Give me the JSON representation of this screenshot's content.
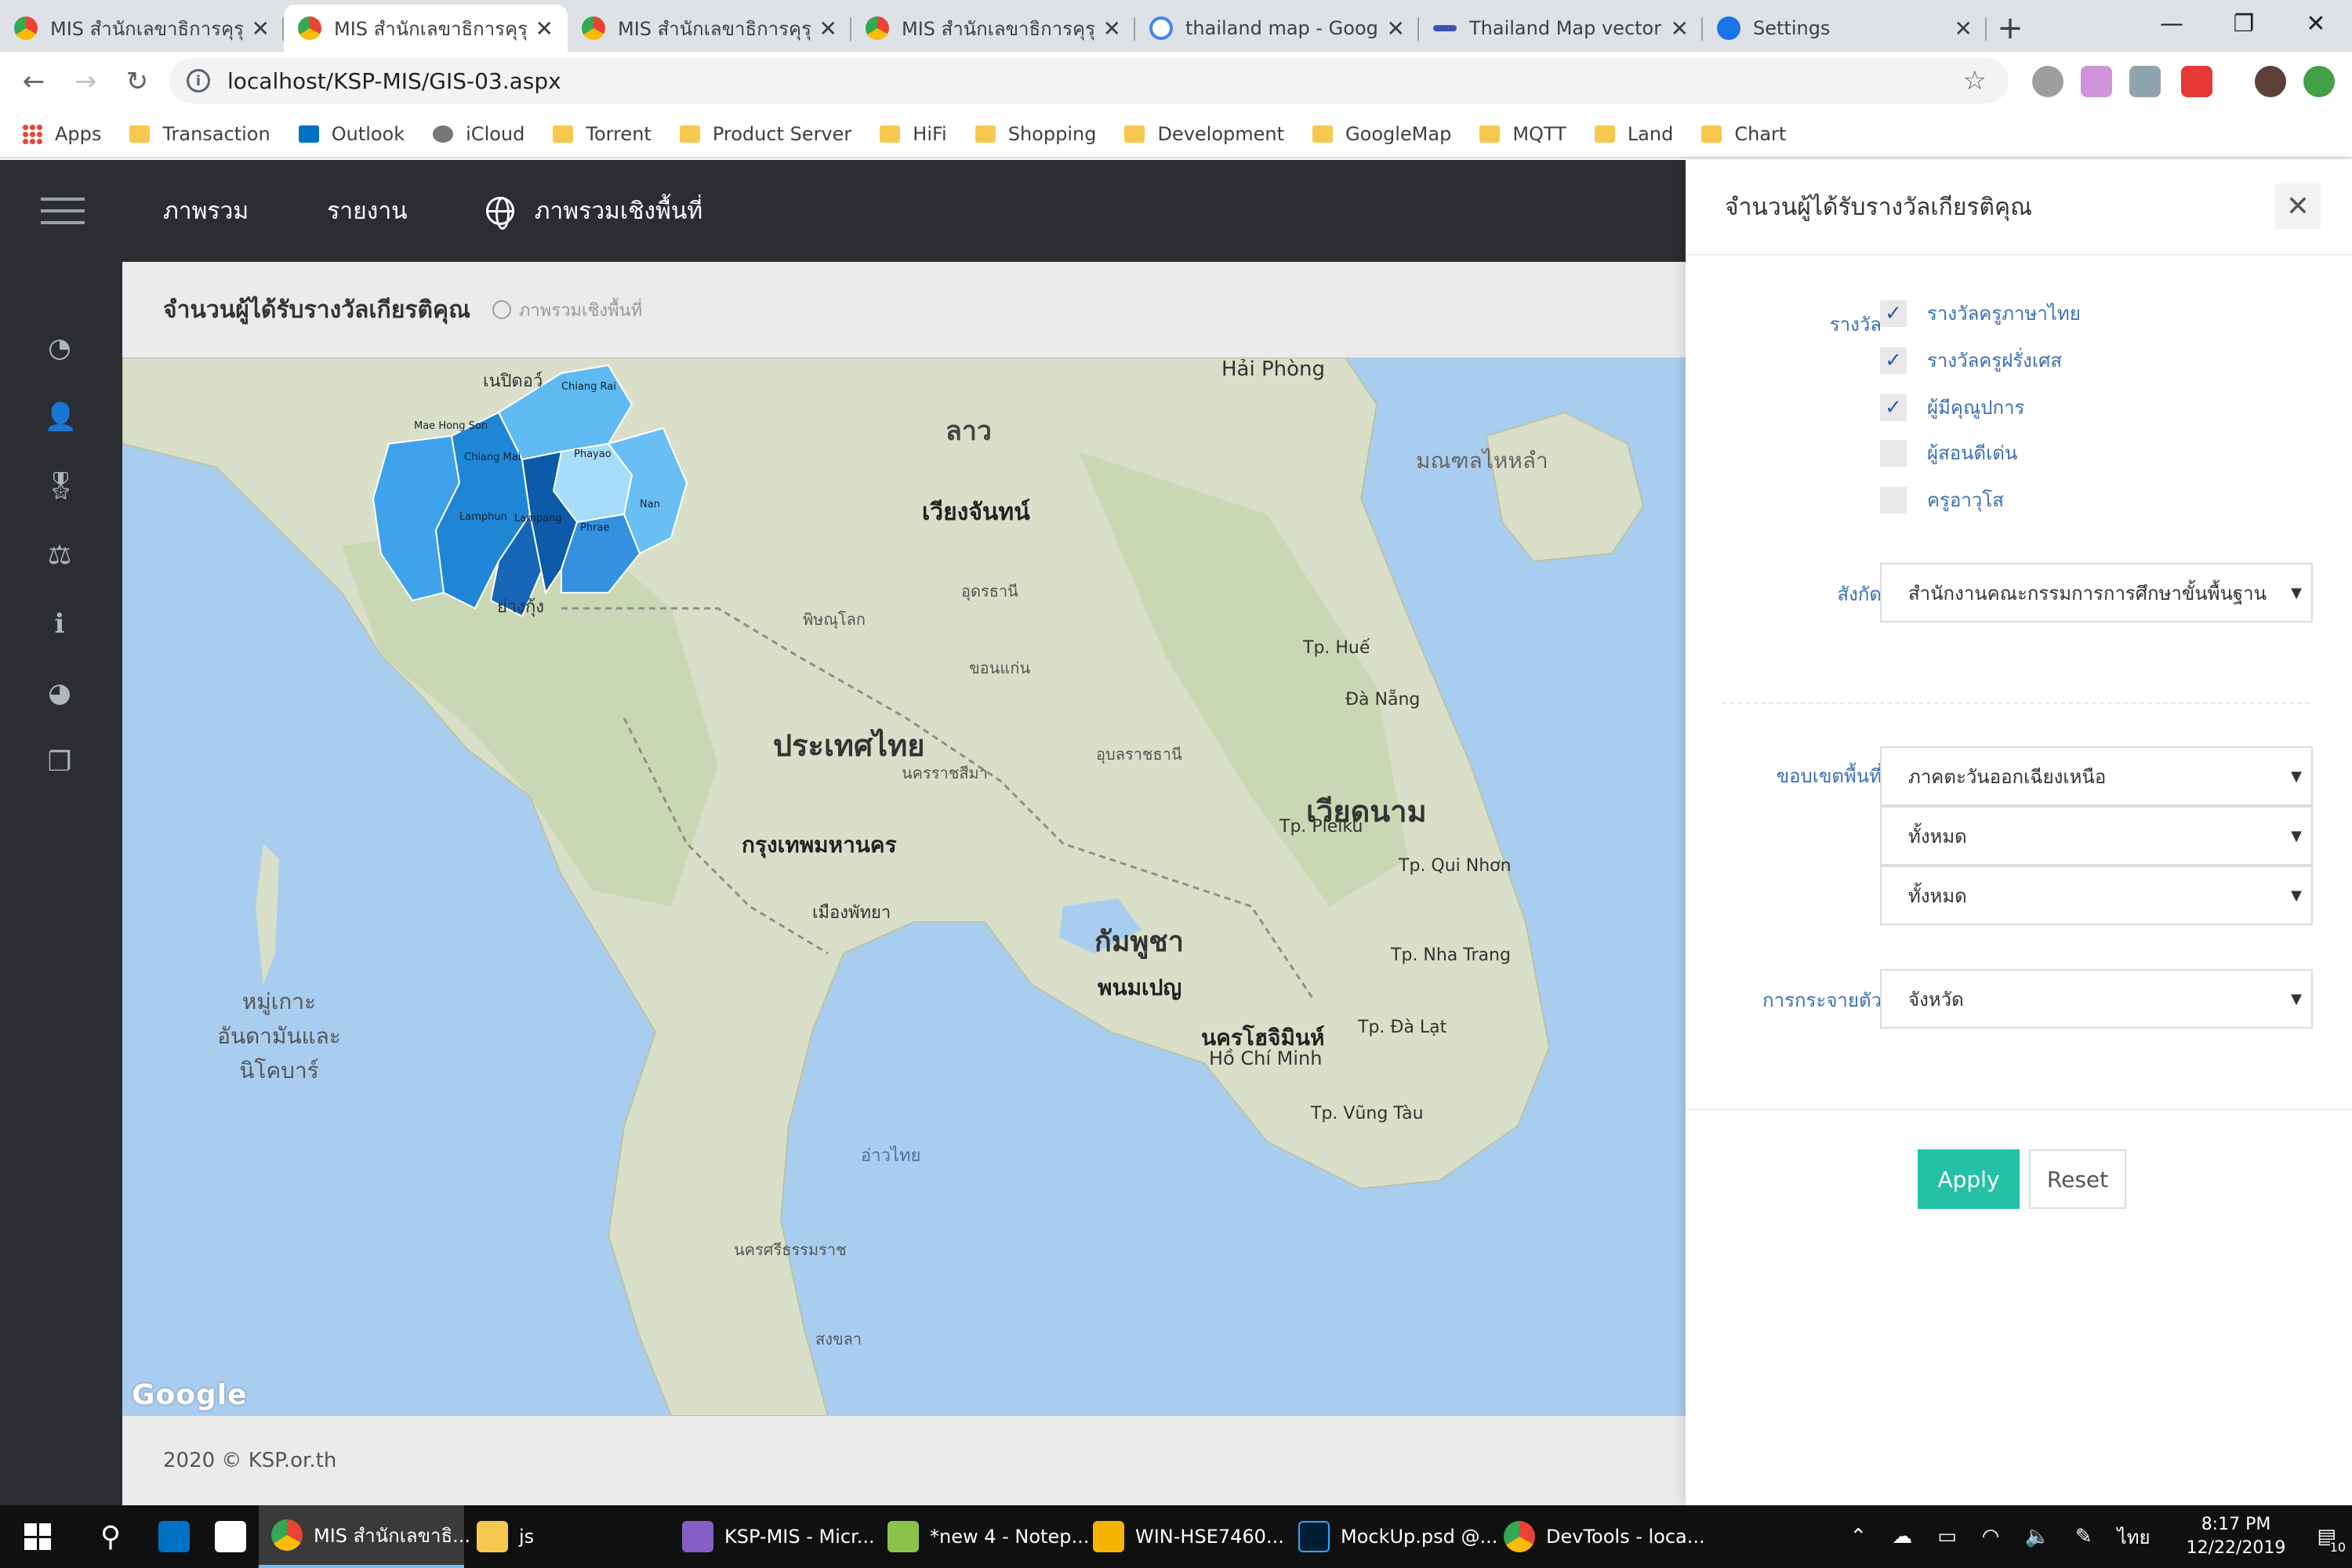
{
  "browser": {
    "tabs": [
      {
        "title": "MIS สำนักเลขาธิการคุรุสภา",
        "active": false
      },
      {
        "title": "MIS สำนักเลขาธิการคุรุสภา",
        "active": true
      },
      {
        "title": "MIS สำนักเลขาธิการคุรุสภา",
        "active": false
      },
      {
        "title": "MIS สำนักเลขาธิการคุรุสภา",
        "active": false
      },
      {
        "title": "thailand map - Google Search",
        "active": false
      },
      {
        "title": "Thailand Map vector free",
        "active": false
      },
      {
        "title": "Settings",
        "active": false
      }
    ],
    "url": "localhost/KSP-MIS/GIS-03.aspx",
    "bookmarks": [
      "Apps",
      "Transaction",
      "Outlook",
      "iCloud",
      "Torrent",
      "Product Server",
      "HiFi",
      "Shopping",
      "Development",
      "GoogleMap",
      "MQTT",
      "Land",
      "Chart"
    ]
  },
  "app": {
    "nav": {
      "overview": "ภาพรวม",
      "report": "รายงาน",
      "geo": "ภาพรวมเชิงพื้นที่"
    },
    "page_title": "จำนวนผู้ได้รับรางวัลเกียรติคุณ",
    "breadcrumb_sub": "ภาพรวมเชิงพื้นที่",
    "footer": "2020 © KSP.or.th",
    "map": {
      "google_logo": "Google",
      "provinces": [
        "Mae Hong Son",
        "Chiang Rai",
        "Chiang Mai",
        "Phayao",
        "Lamphun",
        "Lampang",
        "Phrae",
        "Nan"
      ],
      "labels": [
        {
          "text": "ลาว"
        },
        {
          "text": "ประเทศไทย"
        },
        {
          "text": "กรุงเทพมหานคร"
        },
        {
          "text": "กัมพูชา"
        },
        {
          "text": "เวียดนาม"
        },
        {
          "text": "เวียงจันทน์"
        },
        {
          "text": "พนมเปญ"
        },
        {
          "text": "นครโฮจิมินห์"
        },
        {
          "text": "Hải Phòng"
        },
        {
          "text": "มณฑลไหหลำ"
        },
        {
          "text": "อ่าวไทย"
        },
        {
          "text": "หมู่เกาะอันดามันและนิโคบาร์"
        },
        {
          "text": "Tp. Huế"
        },
        {
          "text": "Đà Nẵng"
        },
        {
          "text": "Tp. Pleiku"
        },
        {
          "text": "Tp. Qui Nhơn"
        },
        {
          "text": "Tp. Nha Trang"
        },
        {
          "text": "Tp. Đà Lạt"
        },
        {
          "text": "Hồ Chí Minh"
        },
        {
          "text": "Tp. Vũng Tàu"
        },
        {
          "text": "ย่างกุ้ง"
        },
        {
          "text": "เนปิดอว์"
        },
        {
          "text": "อุดรธานี"
        },
        {
          "text": "ขอนแก่น"
        },
        {
          "text": "อุบลราชธานี"
        },
        {
          "text": "นครราชสีมา"
        },
        {
          "text": "พิษณุโลก"
        },
        {
          "text": "เมืองพัทยา"
        },
        {
          "text": "สงขลา"
        },
        {
          "text": "นครศรีธรรมราช"
        }
      ]
    }
  },
  "filter": {
    "title": "จำนวนผู้ได้รับรางวัลเกียรติคุณ",
    "award_label": "รางวัล",
    "awards": [
      {
        "label": "รางวัลครูภาษาไทย",
        "checked": true
      },
      {
        "label": "รางวัลครูฝรั่งเศส",
        "checked": true
      },
      {
        "label": "ผู้มีคุณูปการ",
        "checked": true
      },
      {
        "label": "ผู้สอนดีเด่น",
        "checked": false
      },
      {
        "label": "ครูอาวุโส",
        "checked": false
      }
    ],
    "affiliation_label": "สังกัด",
    "affiliation_value": "สำนักงานคณะกรรมการการศึกษาขั้นพื้นฐาน",
    "area_label": "ขอบเขตพื้นที่",
    "area_values": [
      "ภาคตะวันออกเฉียงเหนือ",
      "ทั้งหมด",
      "ทั้งหมด"
    ],
    "distribution_label": "การกระจายตัว",
    "distribution_value": "จังหวัด",
    "apply": "Apply",
    "reset": "Reset"
  },
  "taskbar": {
    "items": [
      "MIS สำนักเลขาธิ...",
      "js",
      "KSP-MIS - Micr...",
      "*new 4 - Notep...",
      "WIN-HSE7460...",
      "MockUp.psd @...",
      "DevTools - loca..."
    ],
    "lang": "ไทย",
    "time": "8:17 PM",
    "date": "12/22/2019",
    "notifications": "10"
  }
}
